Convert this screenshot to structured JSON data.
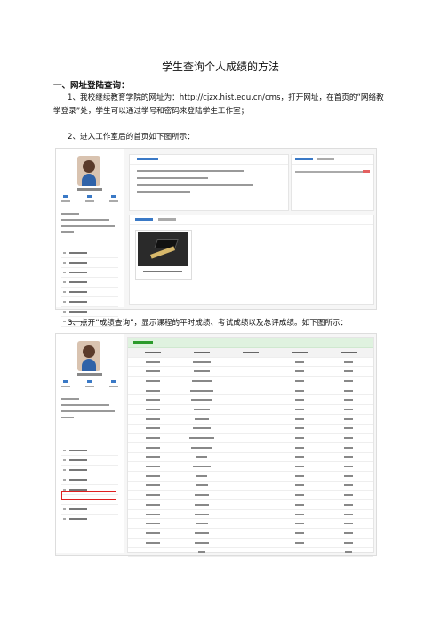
{
  "doc": {
    "title": "学生查询个人成绩的方法",
    "section1_heading": "一、网址登陆查询：",
    "para1": "1、我校继续教育学院的网址为：http://cjzx.hist.edu.cn/cms，打开网址，在首页的“网络教学登录”处，学生可以通过学号和密码来登陆学生工作室；",
    "para2": "2、进入工作室后的首页如下图所示：",
    "para3": "3、点开“成绩查询”，显示课程的平时成绩、考试成绩以及总评成绩。如下图所示："
  }
}
